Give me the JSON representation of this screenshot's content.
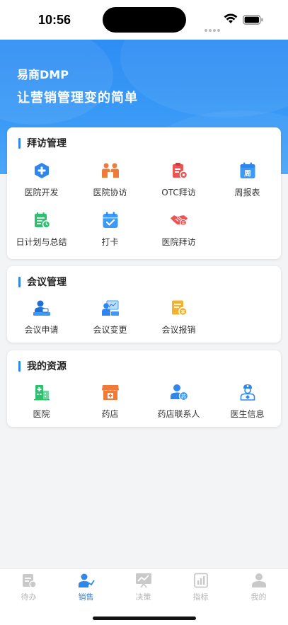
{
  "status_bar": {
    "time": "10:56"
  },
  "hero": {
    "app_name": "易商DMP",
    "slogan": "让营销管理变的简单"
  },
  "sections": [
    {
      "title": "拜访管理",
      "items": [
        {
          "label": "医院开发",
          "icon": "hospital-plus-icon"
        },
        {
          "label": "医院协访",
          "icon": "co-visit-icon"
        },
        {
          "label": "OTC拜访",
          "icon": "otc-clipboard-icon"
        },
        {
          "label": "周报表",
          "icon": "weekly-calendar-icon"
        },
        {
          "label": "日计划与总结",
          "icon": "daily-plan-icon"
        },
        {
          "label": "打卡",
          "icon": "checkin-calendar-icon"
        },
        {
          "label": "医院拜访",
          "icon": "handshake-icon"
        }
      ]
    },
    {
      "title": "会议管理",
      "items": [
        {
          "label": "会议申请",
          "icon": "meeting-apply-icon"
        },
        {
          "label": "会议变更",
          "icon": "meeting-change-icon"
        },
        {
          "label": "会议报销",
          "icon": "meeting-reimburse-icon"
        }
      ]
    },
    {
      "title": "我的资源",
      "items": [
        {
          "label": "医院",
          "icon": "hospital-building-icon"
        },
        {
          "label": "药店",
          "icon": "pharmacy-store-icon"
        },
        {
          "label": "药店联系人",
          "icon": "pharmacy-contact-icon"
        },
        {
          "label": "医生信息",
          "icon": "doctor-icon"
        }
      ]
    }
  ],
  "tabbar": {
    "active": "销售",
    "items": [
      {
        "label": "待办",
        "icon": "todo-icon"
      },
      {
        "label": "销售",
        "icon": "sales-icon"
      },
      {
        "label": "决策",
        "icon": "decision-icon"
      },
      {
        "label": "指标",
        "icon": "metrics-icon"
      },
      {
        "label": "我的",
        "icon": "profile-icon"
      }
    ]
  },
  "colors": {
    "primary": "#2f87ee",
    "hero_gradient_top": "#2e8df3",
    "orange": "#ef7b3a",
    "red": "#ea5454",
    "green": "#2fbf6e",
    "yellow": "#f3b22d",
    "inactive": "#b5b5b5"
  }
}
